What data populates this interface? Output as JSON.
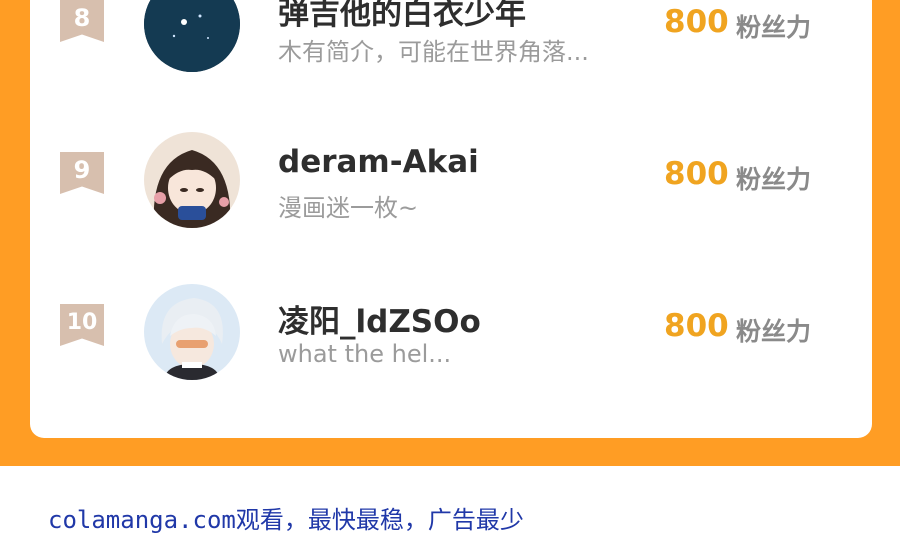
{
  "ranking": [
    {
      "rank": "8",
      "name": "弹吉他的白衣少年",
      "bio": "木有简介，可能在世界角落...",
      "count": "800",
      "unit": "粉丝力",
      "avatar": "night-sky-avatar"
    },
    {
      "rank": "9",
      "name": "deram-Akai",
      "bio": "漫画迷一枚~",
      "count": "800",
      "unit": "粉丝力",
      "avatar": "anime-girl-avatar"
    },
    {
      "rank": "10",
      "name": "凌阳_ldZSOo",
      "bio": "what the hel...",
      "count": "800",
      "unit": "粉丝力",
      "avatar": "white-hair-boy-avatar"
    }
  ],
  "footer": {
    "text": "colamanga.com观看，最快最稳，广告最少"
  },
  "colors": {
    "accent": "#ff9d24",
    "count": "#f0a420",
    "rank_badge": "#d7bfae",
    "footer_link": "#2038a8"
  }
}
